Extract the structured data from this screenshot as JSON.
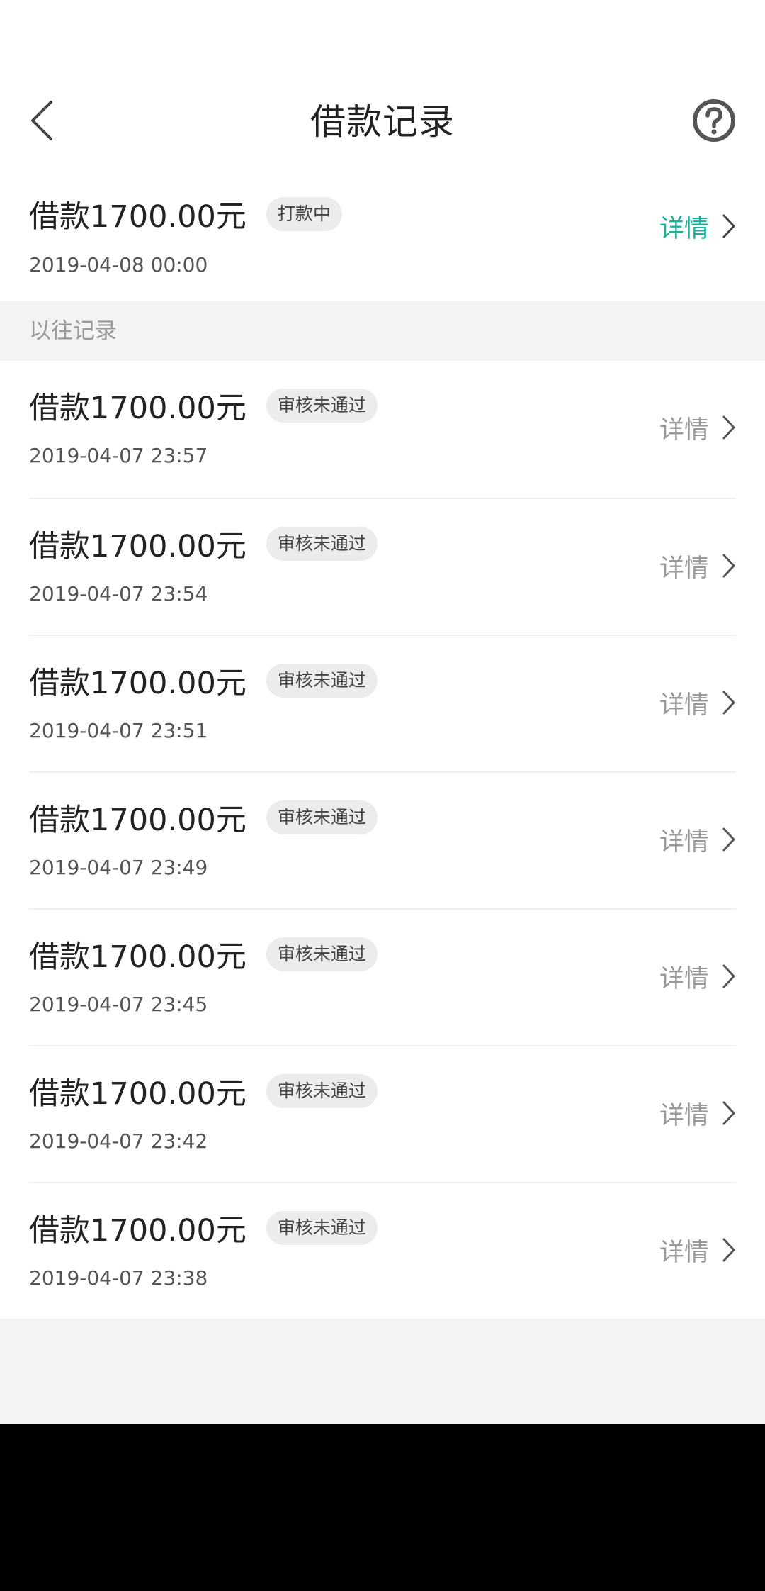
{
  "header": {
    "title": "借款记录",
    "back_icon": "back-arrow-icon",
    "help_icon": "question-circle-icon"
  },
  "colors": {
    "accent": "#19b2a0",
    "muted": "#999999",
    "badge_bg": "#ececec"
  },
  "current": {
    "amount": "借款1700.00元",
    "status": "打款中",
    "date": "2019-04-08 00:00",
    "detail_label": "详情"
  },
  "history": {
    "section_title": "以往记录",
    "items": [
      {
        "amount": "借款1700.00元",
        "status": "审核未通过",
        "date": "2019-04-07 23:57",
        "detail_label": "详情"
      },
      {
        "amount": "借款1700.00元",
        "status": "审核未通过",
        "date": "2019-04-07 23:54",
        "detail_label": "详情"
      },
      {
        "amount": "借款1700.00元",
        "status": "审核未通过",
        "date": "2019-04-07 23:51",
        "detail_label": "详情"
      },
      {
        "amount": "借款1700.00元",
        "status": "审核未通过",
        "date": "2019-04-07 23:49",
        "detail_label": "详情"
      },
      {
        "amount": "借款1700.00元",
        "status": "审核未通过",
        "date": "2019-04-07 23:45",
        "detail_label": "详情"
      },
      {
        "amount": "借款1700.00元",
        "status": "审核未通过",
        "date": "2019-04-07 23:42",
        "detail_label": "详情"
      },
      {
        "amount": "借款1700.00元",
        "status": "审核未通过",
        "date": "2019-04-07 23:38",
        "detail_label": "详情"
      }
    ]
  }
}
